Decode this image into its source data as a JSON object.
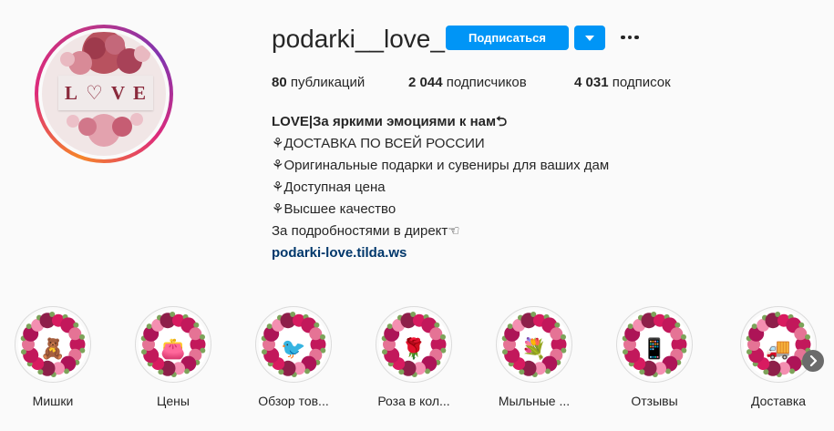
{
  "profile": {
    "username": "podarki__love_",
    "avatar_text": "L♡VE",
    "follow_label": "Подписаться",
    "dropdown_icon": "caret-down-icon",
    "more_icon": "more-options-icon"
  },
  "stats": {
    "posts_value": "80",
    "posts_label": " публикаций",
    "followers_value": "2 044",
    "followers_label": " подписчиков",
    "following_value": "4 031",
    "following_label": " подписок"
  },
  "bio": {
    "name": "LOVE|За яркими эмоциями к нам",
    "lines": [
      "ДОСТАВКА ПО ВСЕЙ РОССИИ",
      "Оригинальные подарки и сувениры для ваших дам",
      "Доступная цена",
      "Высшее качество"
    ],
    "footer": "За подробностями в директ",
    "link": "podarki-love.tilda.ws"
  },
  "highlights": [
    {
      "label": "Мишки",
      "icon": "teddy-bear-icon"
    },
    {
      "label": "Цены",
      "icon": "purse-icon"
    },
    {
      "label": "Обзор тов...",
      "icon": "bird-icon"
    },
    {
      "label": "Роза в кол...",
      "icon": "rose-dome-icon"
    },
    {
      "label": "Мыльные ...",
      "icon": "soap-flowers-icon"
    },
    {
      "label": "Отзывы",
      "icon": "phone-review-icon"
    },
    {
      "label": "Доставка",
      "icon": "truck-icon"
    }
  ],
  "colors": {
    "accent": "#0095f6",
    "link": "#00376b",
    "text": "#262626",
    "background": "#fafafa"
  }
}
